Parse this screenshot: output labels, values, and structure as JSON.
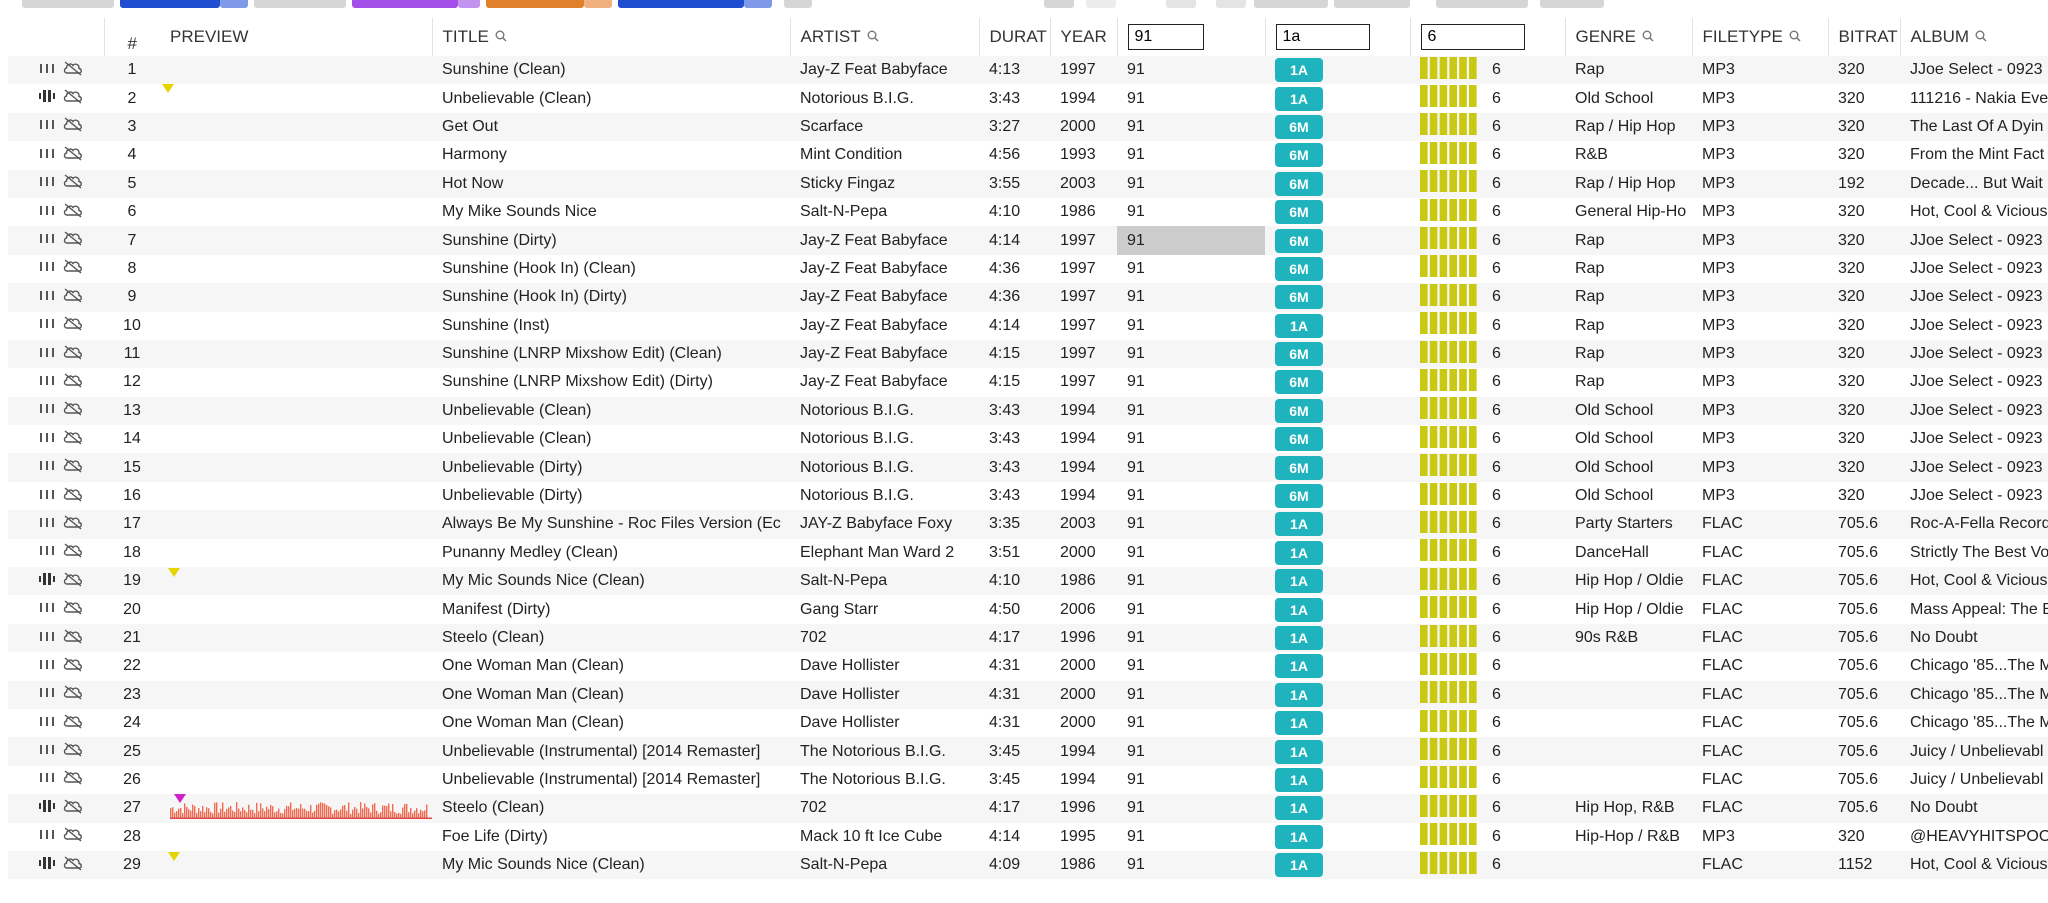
{
  "colors": {
    "key_badge": "#1fb3be",
    "energy": "#c9c914",
    "marker_yellow": "#e6d400",
    "marker_magenta": "#d020c8",
    "waveform": "#ef6a50"
  },
  "header": {
    "num": "#",
    "preview": "PREVIEW",
    "title": "TITLE",
    "artist": "ARTIST",
    "duration": "DURAT",
    "year": "YEAR",
    "genre": "GENRE",
    "filetype": "FILETYPE",
    "bitrate": "BITRAT",
    "album": "ALBUM"
  },
  "filters": {
    "bpm": "91",
    "key": "1a",
    "energy": "6"
  },
  "tracks": [
    {
      "n": "1",
      "title": "Sunshine (Clean)",
      "artist": "Jay-Z Feat Babyface",
      "dur": "4:13",
      "year": "1997",
      "bpm": "91",
      "key": "1A",
      "energy": "6",
      "genre": "Rap",
      "ftype": "MP3",
      "bitrate": "320",
      "album": "JJoe Select - 0923"
    },
    {
      "n": "2",
      "title": "Unbelievable (Clean)",
      "artist": "Notorious B.I.G.",
      "dur": "3:43",
      "year": "1994",
      "bpm": "91",
      "key": "1A",
      "energy": "6",
      "genre": "Old School",
      "ftype": "MP3",
      "bitrate": "320",
      "album": "111216 - Nakia Eve"
    },
    {
      "n": "3",
      "title": "Get Out",
      "artist": "Scarface",
      "dur": "3:27",
      "year": "2000",
      "bpm": "91",
      "key": "6M",
      "energy": "6",
      "genre": "Rap / Hip Hop",
      "ftype": "MP3",
      "bitrate": "320",
      "album": "The Last Of A Dyin"
    },
    {
      "n": "4",
      "title": "Harmony",
      "artist": "Mint Condition",
      "dur": "4:56",
      "year": "1993",
      "bpm": "91",
      "key": "6M",
      "energy": "6",
      "genre": "R&B",
      "ftype": "MP3",
      "bitrate": "320",
      "album": "From the Mint Fact"
    },
    {
      "n": "5",
      "title": "Hot Now",
      "artist": "Sticky Fingaz",
      "dur": "3:55",
      "year": "2003",
      "bpm": "91",
      "key": "6M",
      "energy": "6",
      "genre": "Rap / Hip Hop",
      "ftype": "MP3",
      "bitrate": "192",
      "album": "Decade... But Wait"
    },
    {
      "n": "6",
      "title": "My Mike Sounds Nice",
      "artist": "Salt-N-Pepa",
      "dur": "4:10",
      "year": "1986",
      "bpm": "91",
      "key": "6M",
      "energy": "6",
      "genre": "General Hip-Ho",
      "ftype": "MP3",
      "bitrate": "320",
      "album": "Hot, Cool & Vicious"
    },
    {
      "n": "7",
      "title": "Sunshine (Dirty)",
      "artist": "Jay-Z Feat Babyface",
      "dur": "4:14",
      "year": "1997",
      "bpm": "91",
      "key": "6M",
      "energy": "6",
      "genre": "Rap",
      "ftype": "MP3",
      "bitrate": "320",
      "album": "JJoe Select - 0923"
    },
    {
      "n": "8",
      "title": "Sunshine (Hook In) (Clean)",
      "artist": "Jay-Z Feat Babyface",
      "dur": "4:36",
      "year": "1997",
      "bpm": "91",
      "key": "6M",
      "energy": "6",
      "genre": "Rap",
      "ftype": "MP3",
      "bitrate": "320",
      "album": "JJoe Select - 0923"
    },
    {
      "n": "9",
      "title": "Sunshine (Hook In) (Dirty)",
      "artist": "Jay-Z Feat Babyface",
      "dur": "4:36",
      "year": "1997",
      "bpm": "91",
      "key": "6M",
      "energy": "6",
      "genre": "Rap",
      "ftype": "MP3",
      "bitrate": "320",
      "album": "JJoe Select - 0923"
    },
    {
      "n": "10",
      "title": "Sunshine (Inst)",
      "artist": "Jay-Z Feat Babyface",
      "dur": "4:14",
      "year": "1997",
      "bpm": "91",
      "key": "1A",
      "energy": "6",
      "genre": "Rap",
      "ftype": "MP3",
      "bitrate": "320",
      "album": "JJoe Select - 0923"
    },
    {
      "n": "11",
      "title": "Sunshine (LNRP Mixshow Edit) (Clean)",
      "artist": "Jay-Z Feat Babyface",
      "dur": "4:15",
      "year": "1997",
      "bpm": "91",
      "key": "6M",
      "energy": "6",
      "genre": "Rap",
      "ftype": "MP3",
      "bitrate": "320",
      "album": "JJoe Select - 0923"
    },
    {
      "n": "12",
      "title": "Sunshine (LNRP Mixshow Edit) (Dirty)",
      "artist": "Jay-Z Feat Babyface",
      "dur": "4:15",
      "year": "1997",
      "bpm": "91",
      "key": "6M",
      "energy": "6",
      "genre": "Rap",
      "ftype": "MP3",
      "bitrate": "320",
      "album": "JJoe Select - 0923"
    },
    {
      "n": "13",
      "title": "Unbelievable (Clean)",
      "artist": "Notorious B.I.G.",
      "dur": "3:43",
      "year": "1994",
      "bpm": "91",
      "key": "6M",
      "energy": "6",
      "genre": "Old School",
      "ftype": "MP3",
      "bitrate": "320",
      "album": "JJoe Select - 0923"
    },
    {
      "n": "14",
      "title": "Unbelievable (Clean)",
      "artist": "Notorious B.I.G.",
      "dur": "3:43",
      "year": "1994",
      "bpm": "91",
      "key": "6M",
      "energy": "6",
      "genre": "Old School",
      "ftype": "MP3",
      "bitrate": "320",
      "album": "JJoe Select - 0923"
    },
    {
      "n": "15",
      "title": "Unbelievable (Dirty)",
      "artist": "Notorious B.I.G.",
      "dur": "3:43",
      "year": "1994",
      "bpm": "91",
      "key": "6M",
      "energy": "6",
      "genre": "Old School",
      "ftype": "MP3",
      "bitrate": "320",
      "album": "JJoe Select - 0923"
    },
    {
      "n": "16",
      "title": "Unbelievable (Dirty)",
      "artist": "Notorious B.I.G.",
      "dur": "3:43",
      "year": "1994",
      "bpm": "91",
      "key": "6M",
      "energy": "6",
      "genre": "Old School",
      "ftype": "MP3",
      "bitrate": "320",
      "album": "JJoe Select - 0923"
    },
    {
      "n": "17",
      "title": "Always Be My Sunshine - Roc Files Version (Ec",
      "artist": "JAY-Z Babyface Foxy",
      "dur": "3:35",
      "year": "2003",
      "bpm": "91",
      "key": "1A",
      "energy": "6",
      "genre": "Party Starters",
      "ftype": "FLAC",
      "bitrate": "705.6",
      "album": "Roc-A-Fella Record"
    },
    {
      "n": "18",
      "title": "Punanny Medley (Clean)",
      "artist": "Elephant Man Ward 2",
      "dur": "3:51",
      "year": "2000",
      "bpm": "91",
      "key": "1A",
      "energy": "6",
      "genre": "DanceHall",
      "ftype": "FLAC",
      "bitrate": "705.6",
      "album": "Strictly The Best Vo"
    },
    {
      "n": "19",
      "title": "My Mic Sounds Nice (Clean)",
      "artist": "Salt-N-Pepa",
      "dur": "4:10",
      "year": "1986",
      "bpm": "91",
      "key": "1A",
      "energy": "6",
      "genre": "Hip Hop / Oldie",
      "ftype": "FLAC",
      "bitrate": "705.6",
      "album": "Hot, Cool & Vicious"
    },
    {
      "n": "20",
      "title": "Manifest (Dirty)",
      "artist": "Gang Starr",
      "dur": "4:50",
      "year": "2006",
      "bpm": "91",
      "key": "1A",
      "energy": "6",
      "genre": "Hip Hop / Oldie",
      "ftype": "FLAC",
      "bitrate": "705.6",
      "album": "Mass Appeal: The B"
    },
    {
      "n": "21",
      "title": "Steelo (Clean)",
      "artist": "702",
      "dur": "4:17",
      "year": "1996",
      "bpm": "91",
      "key": "1A",
      "energy": "6",
      "genre": "90s R&B",
      "ftype": "FLAC",
      "bitrate": "705.6",
      "album": "No Doubt"
    },
    {
      "n": "22",
      "title": "One Woman Man (Clean)",
      "artist": "Dave Hollister",
      "dur": "4:31",
      "year": "2000",
      "bpm": "91",
      "key": "1A",
      "energy": "6",
      "genre": "",
      "ftype": "FLAC",
      "bitrate": "705.6",
      "album": "Chicago '85...The M"
    },
    {
      "n": "23",
      "title": "One Woman Man (Clean)",
      "artist": "Dave Hollister",
      "dur": "4:31",
      "year": "2000",
      "bpm": "91",
      "key": "1A",
      "energy": "6",
      "genre": "",
      "ftype": "FLAC",
      "bitrate": "705.6",
      "album": "Chicago '85...The M"
    },
    {
      "n": "24",
      "title": "One Woman Man (Clean)",
      "artist": "Dave Hollister",
      "dur": "4:31",
      "year": "2000",
      "bpm": "91",
      "key": "1A",
      "energy": "6",
      "genre": "",
      "ftype": "FLAC",
      "bitrate": "705.6",
      "album": "Chicago '85...The M"
    },
    {
      "n": "25",
      "title": "Unbelievable (Instrumental) [2014 Remaster]",
      "artist": "The Notorious B.I.G.",
      "dur": "3:45",
      "year": "1994",
      "bpm": "91",
      "key": "1A",
      "energy": "6",
      "genre": "",
      "ftype": "FLAC",
      "bitrate": "705.6",
      "album": "Juicy / Unbelievabl"
    },
    {
      "n": "26",
      "title": "Unbelievable (Instrumental) [2014 Remaster]",
      "artist": "The Notorious B.I.G.",
      "dur": "3:45",
      "year": "1994",
      "bpm": "91",
      "key": "1A",
      "energy": "6",
      "genre": "",
      "ftype": "FLAC",
      "bitrate": "705.6",
      "album": "Juicy / Unbelievabl"
    },
    {
      "n": "27",
      "title": "Steelo (Clean)",
      "artist": "702",
      "dur": "4:17",
      "year": "1996",
      "bpm": "91",
      "key": "1A",
      "energy": "6",
      "genre": "Hip Hop, R&B",
      "ftype": "FLAC",
      "bitrate": "705.6",
      "album": "No Doubt"
    },
    {
      "n": "28",
      "title": "Foe Life (Dirty)",
      "artist": "Mack 10 ft Ice Cube",
      "dur": "4:14",
      "year": "1995",
      "bpm": "91",
      "key": "1A",
      "energy": "6",
      "genre": "Hip-Hop / R&B",
      "ftype": "MP3",
      "bitrate": "320",
      "album": "@HEAVYHITSPOO"
    },
    {
      "n": "29",
      "title": "My Mic Sounds Nice (Clean)",
      "artist": "Salt-N-Pepa",
      "dur": "4:09",
      "year": "1986",
      "bpm": "91",
      "key": "1A",
      "energy": "6",
      "genre": "",
      "ftype": "FLAC",
      "bitrate": "1152",
      "album": "Hot, Cool & Vicious"
    }
  ]
}
